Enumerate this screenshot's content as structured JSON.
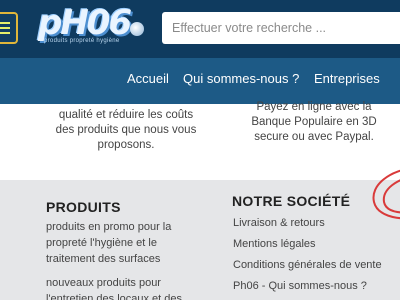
{
  "header": {
    "logo_text": "pH06",
    "logo_tagline": "produits propreté hygiène",
    "search_placeholder": "Effectuer votre recherche ..."
  },
  "nav": {
    "items": [
      "Accueil",
      "Qui sommes-nous ?",
      "Entreprises"
    ]
  },
  "intro": {
    "left_text": [
      "qualité et réduire les coûts",
      "des produits que nous vous",
      "proposons."
    ],
    "right_text": [
      "Payez en ligne avec la",
      "Banque Populaire en 3D",
      "secure ou avec Paypal."
    ]
  },
  "footer": {
    "produits": {
      "heading": "PRODUITS",
      "paragraph_1": [
        "produits en promo pour la",
        "propreté l'hygiène et le",
        "traitement des surfaces"
      ],
      "paragraph_2": [
        "nouveaux produits pour",
        "l'entretien des locaux et des"
      ]
    },
    "societe": {
      "heading": "NOTRE SOCIÉTÉ",
      "links": [
        "Livraison & retours",
        "Mentions légales",
        "Conditions générales de vente",
        "Ph06 - Qui sommes-nous ?"
      ]
    }
  },
  "colors": {
    "header_bg": "#0f3b5f",
    "nav_bg": "#1d5a86",
    "footer_bg": "#e5e6e8",
    "accent_red": "#d93a3a",
    "menu_border": "#e0b63a"
  }
}
